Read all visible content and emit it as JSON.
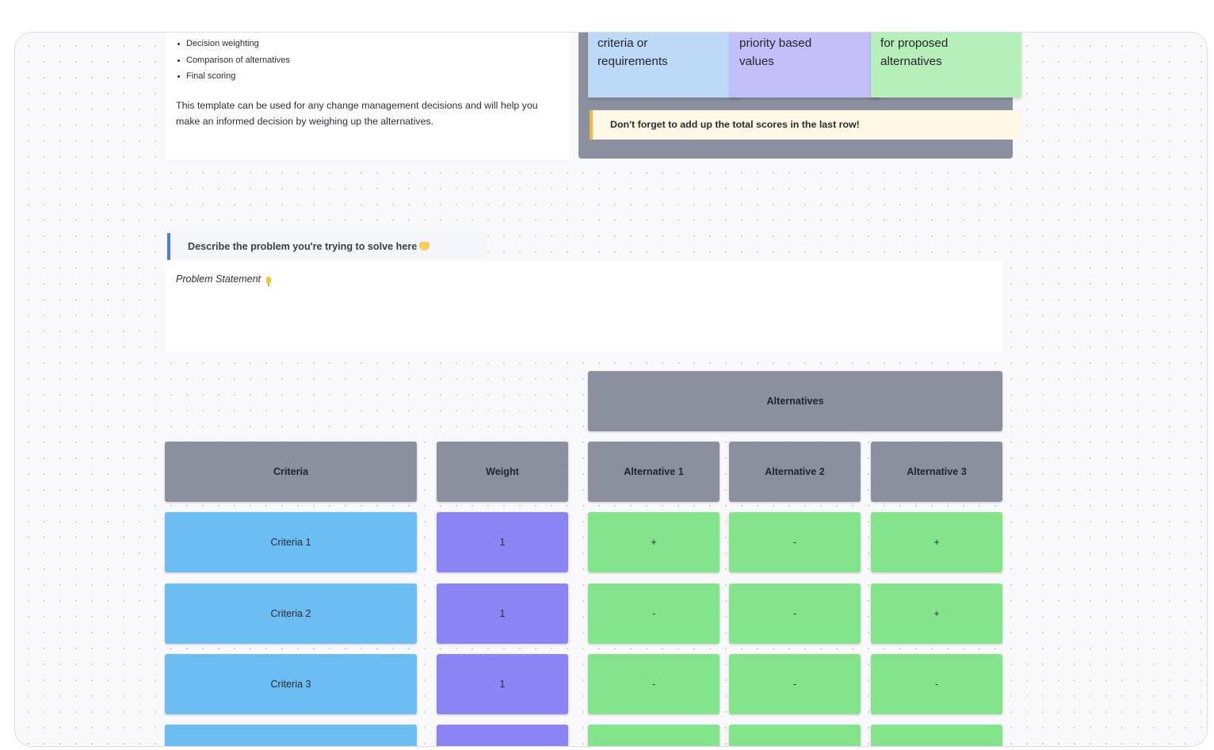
{
  "intro": {
    "items": [
      "Decision weighting",
      "Comparison of alternatives",
      "Final scoring"
    ],
    "description": "This template can be used for any change management decisions and will help you make an informed decision by weighing up the alternatives."
  },
  "instructions": {
    "stickies": [
      {
        "line1": "criteria or",
        "line2": "requirements",
        "color": "#bcd9f8"
      },
      {
        "line1": "priority based",
        "line2": "values",
        "color": "#c3bff8"
      },
      {
        "line1": "for proposed",
        "line2": "alternatives",
        "color": "#b7efb8"
      }
    ],
    "note": "Don't forget to add up the total scores in the last row!"
  },
  "problem": {
    "heading": "Describe the problem you're trying to solve here",
    "label": "Problem Statement"
  },
  "matrix": {
    "alternatives_label": "Alternatives",
    "headers": {
      "criteria": "Criteria",
      "weight": "Weight",
      "alternatives": [
        "Alternative 1",
        "Alternative 2",
        "Alternative 3"
      ]
    },
    "rows": [
      {
        "criteria": "Criteria 1",
        "weight": "1",
        "values": [
          "+",
          "-",
          "+"
        ]
      },
      {
        "criteria": "Criteria 2",
        "weight": "1",
        "values": [
          "-",
          "-",
          "+"
        ]
      },
      {
        "criteria": "Criteria 3",
        "weight": "1",
        "values": [
          "-",
          "-",
          "-"
        ]
      },
      {
        "criteria": "",
        "weight": "",
        "values": [
          "",
          "",
          ""
        ]
      }
    ]
  },
  "colors": {
    "header": "#8a909d",
    "criteria": "#6cbdf2",
    "weight": "#8a84f5",
    "alternative": "#84e48c",
    "accent_note": "#f1b845",
    "accent_heading": "#4d7de0"
  }
}
